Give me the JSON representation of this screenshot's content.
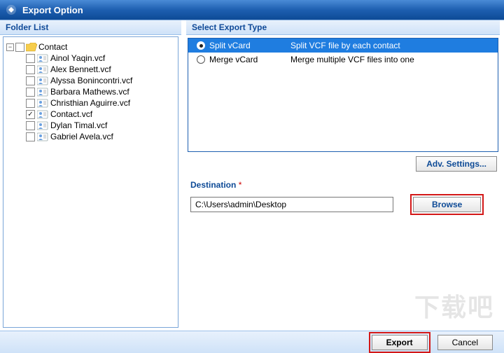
{
  "window": {
    "title": "Export Option"
  },
  "folder_panel": {
    "header": "Folder List",
    "root_toggle": "−",
    "root_name": "Contact",
    "items": [
      {
        "name": "Ainol Yaqin.vcf",
        "checked": false
      },
      {
        "name": "Alex Bennett.vcf",
        "checked": false
      },
      {
        "name": "Alyssa Bonincontri.vcf",
        "checked": false
      },
      {
        "name": "Barbara Mathews.vcf",
        "checked": false
      },
      {
        "name": "Christhian Aguirre.vcf",
        "checked": false
      },
      {
        "name": "Contact.vcf",
        "checked": true
      },
      {
        "name": "Dylan Timal.vcf",
        "checked": false
      },
      {
        "name": "Gabriel Avela.vcf",
        "checked": false
      }
    ]
  },
  "export_panel": {
    "header": "Select Export Type",
    "options": [
      {
        "name": "Split vCard",
        "desc": "Split VCF file by each contact",
        "selected": true
      },
      {
        "name": "Merge vCard",
        "desc": "Merge multiple VCF files into one",
        "selected": false
      }
    ],
    "adv_settings_label": "Adv. Settings...",
    "destination_label": "Destination",
    "destination_required": "*",
    "destination_value": "C:\\Users\\admin\\Desktop",
    "browse_label": "Browse"
  },
  "footer": {
    "export_label": "Export",
    "cancel_label": "Cancel"
  },
  "watermark": "下载吧"
}
